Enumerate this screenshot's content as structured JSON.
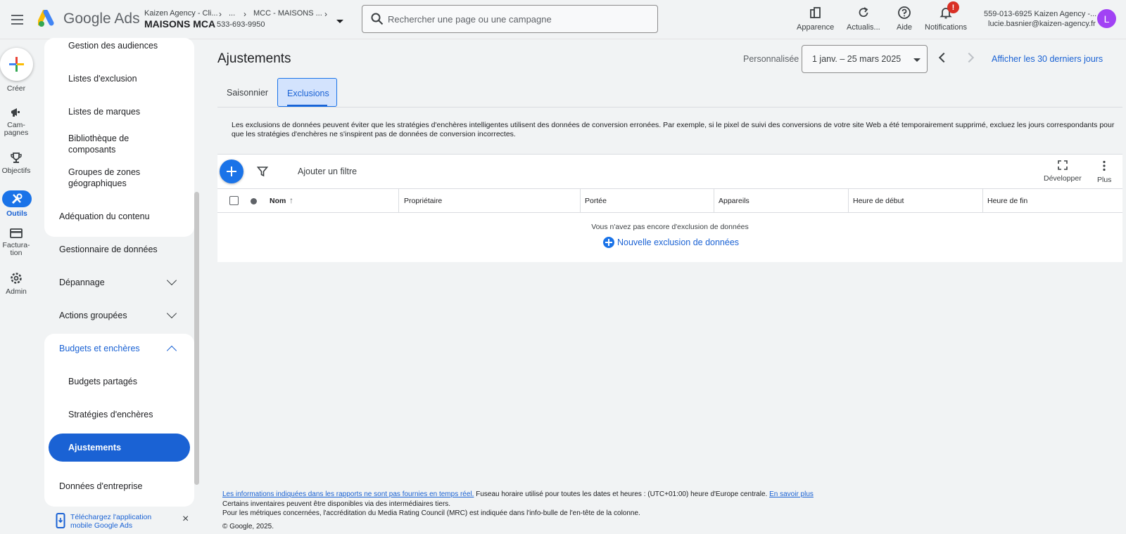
{
  "header": {
    "brand": "Google Ads",
    "breadcrumb": [
      "Kaizen Agency - Cli...",
      "...",
      "MCC - MAISONS ..."
    ],
    "account_name": "MAISONS MCA",
    "account_id": "533-693-9950",
    "search_placeholder": "Rechercher une page ou une campagne",
    "buttons": [
      {
        "label": "Apparence",
        "icon": "appearance-icon"
      },
      {
        "label": "Actualis...",
        "icon": "refresh-icon"
      },
      {
        "label": "Aide",
        "icon": "help-icon"
      },
      {
        "label": "Notifications",
        "icon": "bell-icon",
        "badge": "!"
      }
    ],
    "user_line1": "559-013-6925 Kaizen Agency -...",
    "user_line2": "lucie.basnier@kaizen-agency.fr",
    "avatar_letter": "L"
  },
  "rail": [
    {
      "label": "Créer"
    },
    {
      "label": "Cam-\npagnes"
    },
    {
      "label": "Objectifs"
    },
    {
      "label": "Outils"
    },
    {
      "label": "Factura-\ntion"
    },
    {
      "label": "Admin"
    }
  ],
  "sidebar": {
    "group1": [
      "Gestion des audiences",
      "Listes d'exclusion",
      "Listes de marques",
      "Bibliothèque de composants",
      "Groupes de zones géographiques"
    ],
    "standalone": [
      "Adéquation du contenu",
      "Gestionnaire de données",
      "Dépannage",
      "Actions groupées"
    ],
    "budgets": {
      "title": "Budgets et enchères",
      "items": [
        "Budgets partagés",
        "Stratégies d'enchères",
        "Ajustements"
      ]
    },
    "after": "Données d'entreprise",
    "download": "Téléchargez l'application mobile Google Ads"
  },
  "main": {
    "title": "Ajustements",
    "date_mode": "Personnalisée",
    "date_range": "1 janv. – 25 mars 2025",
    "last30": "Afficher les 30 derniers jours",
    "tabs": [
      "Saisonnier",
      "Exclusions"
    ],
    "info": "Les exclusions de données peuvent éviter que les stratégies d'enchères intelligentes utilisent des données de conversion erronées. Par exemple, si le pixel de suivi des conversions de votre site Web a été temporairement supprimé, excluez les jours correspondants pour que les stratégies d'enchères ne s'inspirent pas de données de conversion incorrectes.",
    "add_filter": "Ajouter un filtre",
    "expand": "Développer",
    "more": "Plus",
    "columns": [
      "Nom",
      "Propriétaire",
      "Portée",
      "Appareils",
      "Heure de début",
      "Heure de fin"
    ],
    "empty_text": "Vous n'avez pas encore d'exclusion de données",
    "new_exclusion": "Nouvelle exclusion de données"
  },
  "footer": {
    "link1": "Les informations indiquées dans les rapports ne sont pas fournies en temps réel.",
    "text1": " Fuseau horaire utilisé pour toutes les dates et heures : (UTC+01:00) heure d'Europe centrale. ",
    "link2": "En savoir plus",
    "line2": "Certains inventaires peuvent être disponibles via des intermédiaires tiers.",
    "line3": "Pour les métriques concernées, l'accréditation du Media Rating Council (MRC) est indiquée dans l'info-bulle de l'en-tête de la colonne.",
    "copyright": "© Google, 2025."
  }
}
